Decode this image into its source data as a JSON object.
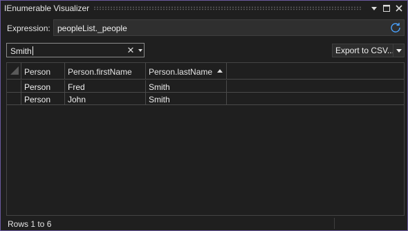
{
  "window": {
    "title": "IEnumerable Visualizer"
  },
  "title_buttons": {
    "menu_icon": "dropdown-triangle",
    "maximize_icon": "maximize",
    "close_icon": "close"
  },
  "expression": {
    "label": "Expression:",
    "value": "peopleList._people",
    "refresh_icon": "refresh"
  },
  "filter": {
    "value": "Smith",
    "clear_icon": "close",
    "dropdown_icon": "chevron-down"
  },
  "export": {
    "label": "Export to CSV...",
    "dropdown_icon": "chevron-down"
  },
  "grid": {
    "columns": [
      {
        "label": "Person"
      },
      {
        "label": "Person.firstName"
      },
      {
        "label": "Person.lastName",
        "sort": "ascending"
      }
    ],
    "rows": [
      [
        "Person",
        "Fred",
        "Smith"
      ],
      [
        "Person",
        "John",
        "Smith"
      ]
    ]
  },
  "status": {
    "text": "Rows 1 to 6"
  },
  "colors": {
    "background": "#1f1f1f",
    "border_accent": "#6b5aa0",
    "refresh_accent": "#4aa3ff"
  }
}
